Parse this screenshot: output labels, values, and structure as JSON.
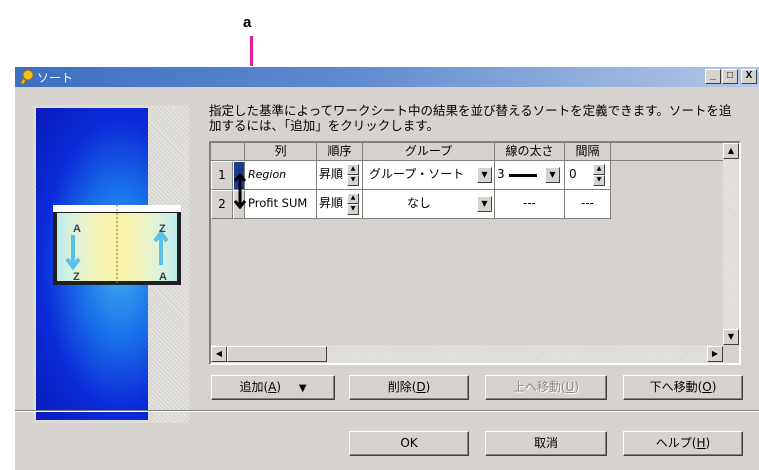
{
  "callout": {
    "letter": "a"
  },
  "window": {
    "title": "ソート",
    "min": "_",
    "max": "□",
    "close": "X"
  },
  "description": "指定した基準によってワークシート中の結果を並び替えるソートを定義できます。ソートを追加するには、「追加」をクリックします。",
  "illustration": {
    "letters": [
      "A",
      "Z",
      "Z",
      "A"
    ]
  },
  "grid": {
    "headers": [
      "列",
      "順序",
      "グループ",
      "線の太さ",
      "間隔"
    ],
    "rows": [
      {
        "num": "1",
        "column": "Region",
        "order": "昇順",
        "group": "グループ・ソート",
        "line_width": "3",
        "spacing": "0"
      },
      {
        "num": "2",
        "column": "Profit SUM",
        "order": "昇順",
        "group": "なし",
        "line_width": "---",
        "spacing": "---"
      }
    ]
  },
  "buttons": {
    "add": {
      "label": "追加(",
      "key": "A",
      "suffix": ")",
      "arrow": "▼"
    },
    "delete": {
      "label": "削除(",
      "key": "D",
      "suffix": ")"
    },
    "move_up": {
      "label": "上へ移動(",
      "key": "U",
      "suffix": ")"
    },
    "move_down": {
      "label": "下へ移動(",
      "key": "O",
      "suffix": ")"
    },
    "ok": {
      "label": "OK"
    },
    "cancel": {
      "label": "取消"
    },
    "help": {
      "label": "ヘルプ(",
      "key": "H",
      "suffix": ")"
    }
  },
  "colors": {
    "accent_callout": "#e020a0",
    "title_blue": "#3c6fc1"
  }
}
